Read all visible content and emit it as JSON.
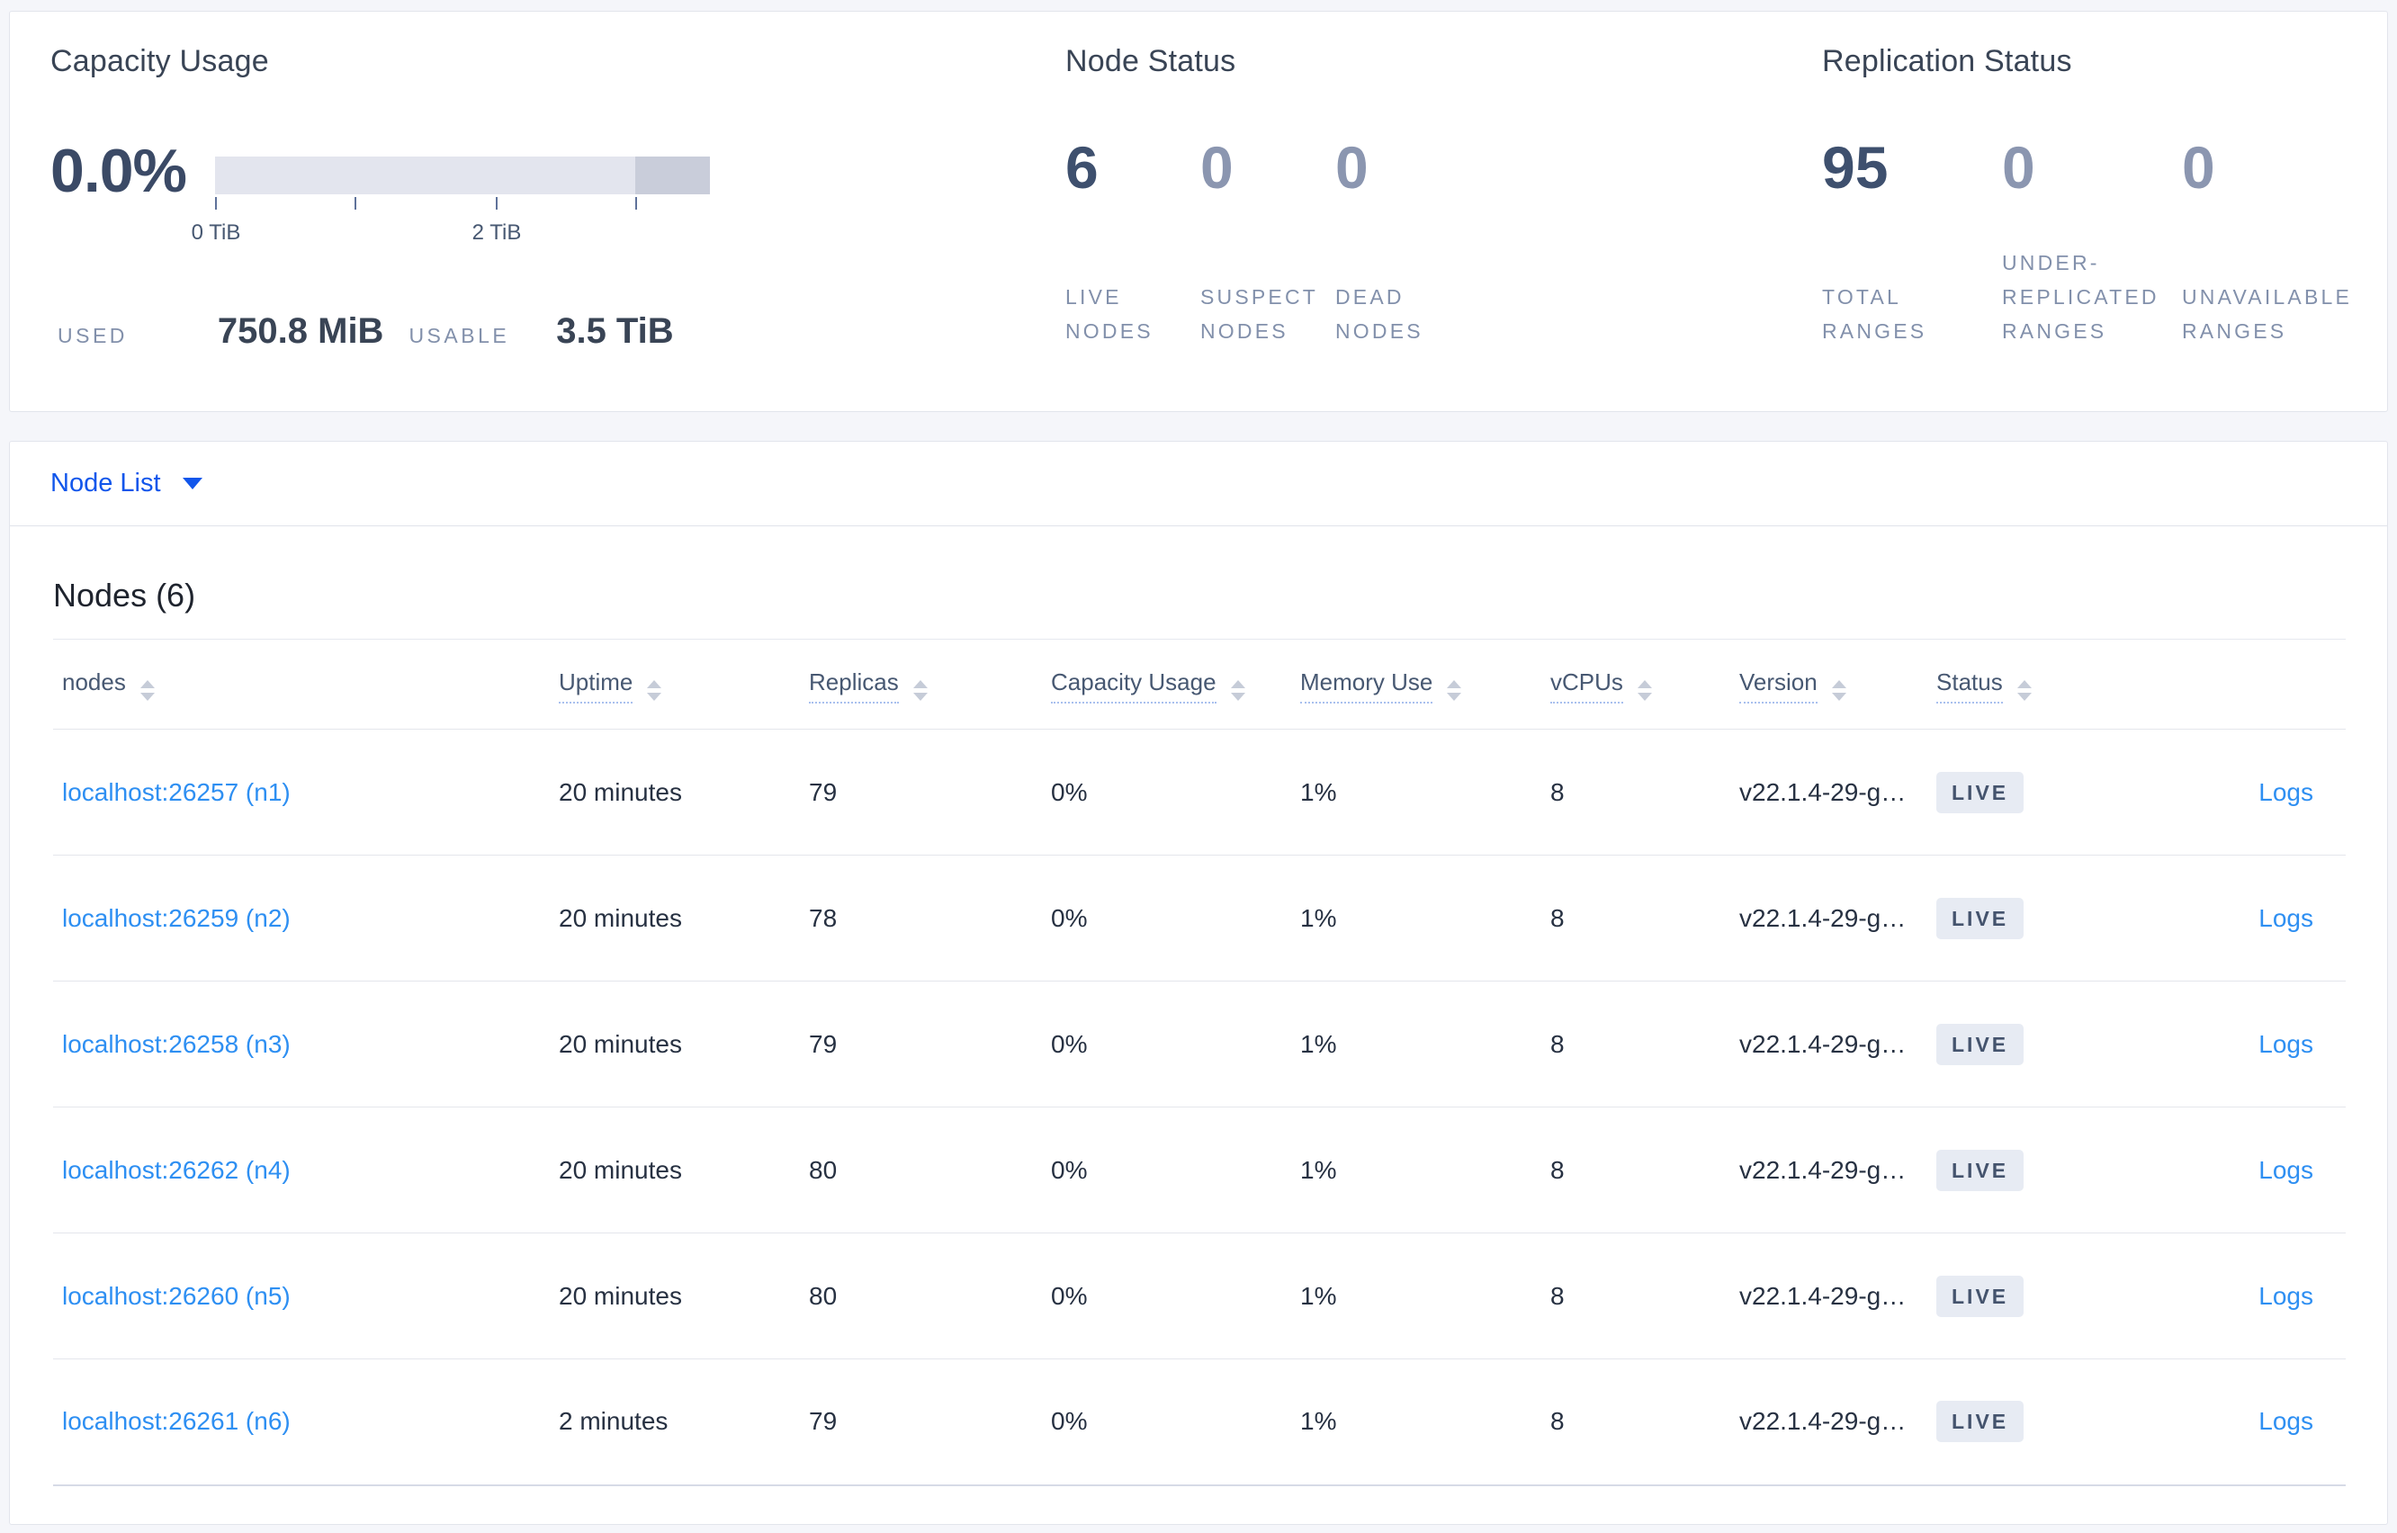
{
  "colors": {
    "nav_blue": "#1156eb",
    "link_blue": "#2e8ff2",
    "badge_bg": "#e7ebf3",
    "badge_text": "#44536d",
    "stat_dark": "#3e506e",
    "stat_dim": "#8b96b0"
  },
  "overview": {
    "capacity": {
      "title": "Capacity Usage",
      "percent": "0.0%",
      "ticks": [
        "0 TiB",
        "2 TiB"
      ],
      "used_label": "USED",
      "used_value": "750.8 MiB",
      "usable_label": "USABLE",
      "usable_value": "3.5 TiB"
    },
    "node_status": {
      "title": "Node Status",
      "stats": [
        {
          "value": "6",
          "label": "LIVE\nNODES",
          "emphasis": true
        },
        {
          "value": "0",
          "label": "SUSPECT\nNODES",
          "emphasis": false
        },
        {
          "value": "0",
          "label": "DEAD\nNODES",
          "emphasis": false
        }
      ]
    },
    "replication": {
      "title": "Replication Status",
      "stats": [
        {
          "value": "95",
          "label": "TOTAL\nRANGES",
          "emphasis": true
        },
        {
          "value": "0",
          "label": "UNDER-\nREPLICATED\nRANGES",
          "emphasis": false
        },
        {
          "value": "0",
          "label": "UNAVAILABLE\nRANGES",
          "emphasis": false
        }
      ]
    }
  },
  "node_list": {
    "toggle_label": "Node List"
  },
  "nodes_section": {
    "heading": "Nodes (6)",
    "columns": [
      {
        "key": "node",
        "label": "nodes",
        "underline": false,
        "sortable": true
      },
      {
        "key": "uptime",
        "label": "Uptime",
        "underline": true,
        "sortable": true
      },
      {
        "key": "replicas",
        "label": "Replicas",
        "underline": true,
        "sortable": true
      },
      {
        "key": "capacity",
        "label": "Capacity Usage",
        "underline": true,
        "sortable": true
      },
      {
        "key": "memory",
        "label": "Memory Use",
        "underline": true,
        "sortable": true
      },
      {
        "key": "vcpus",
        "label": "vCPUs",
        "underline": true,
        "sortable": true
      },
      {
        "key": "version",
        "label": "Version",
        "underline": true,
        "sortable": true
      },
      {
        "key": "status",
        "label": "Status",
        "underline": true,
        "sortable": true
      },
      {
        "key": "logs",
        "label": "",
        "underline": false,
        "sortable": false
      }
    ],
    "rows": [
      {
        "node": "localhost:26257 (n1)",
        "uptime": "20 minutes",
        "replicas": "79",
        "capacity": "0%",
        "memory": "1%",
        "vcpus": "8",
        "version": "v22.1.4-29-g…",
        "status": "LIVE",
        "logs": "Logs"
      },
      {
        "node": "localhost:26259 (n2)",
        "uptime": "20 minutes",
        "replicas": "78",
        "capacity": "0%",
        "memory": "1%",
        "vcpus": "8",
        "version": "v22.1.4-29-g…",
        "status": "LIVE",
        "logs": "Logs"
      },
      {
        "node": "localhost:26258 (n3)",
        "uptime": "20 minutes",
        "replicas": "79",
        "capacity": "0%",
        "memory": "1%",
        "vcpus": "8",
        "version": "v22.1.4-29-g…",
        "status": "LIVE",
        "logs": "Logs"
      },
      {
        "node": "localhost:26262 (n4)",
        "uptime": "20 minutes",
        "replicas": "80",
        "capacity": "0%",
        "memory": "1%",
        "vcpus": "8",
        "version": "v22.1.4-29-g…",
        "status": "LIVE",
        "logs": "Logs"
      },
      {
        "node": "localhost:26260 (n5)",
        "uptime": "20 minutes",
        "replicas": "80",
        "capacity": "0%",
        "memory": "1%",
        "vcpus": "8",
        "version": "v22.1.4-29-g…",
        "status": "LIVE",
        "logs": "Logs"
      },
      {
        "node": "localhost:26261 (n6)",
        "uptime": "2 minutes",
        "replicas": "79",
        "capacity": "0%",
        "memory": "1%",
        "vcpus": "8",
        "version": "v22.1.4-29-g…",
        "status": "LIVE",
        "logs": "Logs"
      }
    ]
  }
}
